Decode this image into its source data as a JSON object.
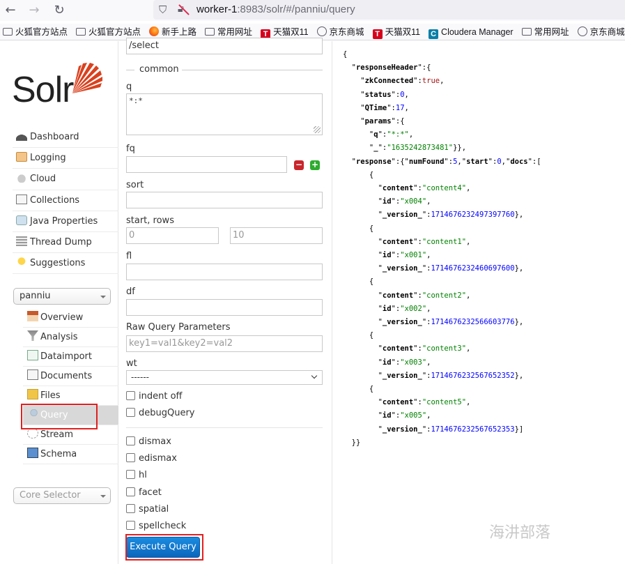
{
  "browser": {
    "url_host": "worker-1",
    "url_rest": ":8983/solr/#/panniu/query",
    "bookmarks": [
      {
        "icon": "folder-icon",
        "label": "火狐官方站点"
      },
      {
        "icon": "folder-icon",
        "label": "火狐官方站点"
      },
      {
        "icon": "firefox-icon",
        "label": "新手上路"
      },
      {
        "icon": "folder-icon",
        "label": "常用网址"
      },
      {
        "icon": "tmall-icon",
        "label": "天猫双11"
      },
      {
        "icon": "globe-icon",
        "label": "京东商城"
      },
      {
        "icon": "tmall-icon",
        "label": "天猫双11"
      },
      {
        "icon": "cloudera-icon",
        "label": "Cloudera Manager"
      },
      {
        "icon": "folder-icon",
        "label": "常用网址"
      },
      {
        "icon": "globe-icon",
        "label": "京东商城"
      }
    ]
  },
  "sidebar": {
    "logo_text": "Solr",
    "main_nav": [
      {
        "label": "Dashboard",
        "icon": "dashboard-icon"
      },
      {
        "label": "Logging",
        "icon": "logging-icon"
      },
      {
        "label": "Cloud",
        "icon": "cloud-icon"
      },
      {
        "label": "Collections",
        "icon": "collections-icon"
      },
      {
        "label": "Java Properties",
        "icon": "java-properties-icon"
      },
      {
        "label": "Thread Dump",
        "icon": "thread-dump-icon"
      },
      {
        "label": "Suggestions",
        "icon": "suggestions-icon"
      }
    ],
    "collection_selected": "panniu",
    "core_nav": [
      {
        "label": "Overview",
        "icon": "overview-icon"
      },
      {
        "label": "Analysis",
        "icon": "analysis-icon"
      },
      {
        "label": "Dataimport",
        "icon": "dataimport-icon"
      },
      {
        "label": "Documents",
        "icon": "documents-icon"
      },
      {
        "label": "Files",
        "icon": "files-icon"
      },
      {
        "label": "Query",
        "icon": "query-icon",
        "active": true
      },
      {
        "label": "Stream",
        "icon": "stream-icon"
      },
      {
        "label": "Schema",
        "icon": "schema-icon"
      }
    ],
    "core_selector_placeholder": "Core Selector"
  },
  "form": {
    "request_handler": "/select",
    "common_legend": "common",
    "q_label": "q",
    "q_value": "*:*",
    "fq_label": "fq",
    "fq_value": "",
    "sort_label": "sort",
    "sort_value": "",
    "start_rows_label": "start, rows",
    "start_placeholder": "0",
    "rows_placeholder": "10",
    "fl_label": "fl",
    "fl_value": "",
    "df_label": "df",
    "df_value": "",
    "raw_label": "Raw Query Parameters",
    "raw_placeholder": "key1=val1&key2=val2",
    "wt_label": "wt",
    "wt_value": "------",
    "checkboxes_top": [
      {
        "label": "indent off",
        "checked": false
      },
      {
        "label": "debugQuery",
        "checked": false
      }
    ],
    "checkboxes_bottom": [
      {
        "label": "dismax",
        "checked": false
      },
      {
        "label": "edismax",
        "checked": false
      },
      {
        "label": "hl",
        "checked": false
      },
      {
        "label": "facet",
        "checked": false
      },
      {
        "label": "spatial",
        "checked": false
      },
      {
        "label": "spellcheck",
        "checked": false
      }
    ],
    "execute_label": "Execute Query"
  },
  "result": {
    "responseHeader": {
      "zkConnected": "true",
      "status": "0",
      "QTime": "17",
      "params": {
        "q": "*:*",
        "_": "1635242873481"
      }
    },
    "response": {
      "numFound": "5",
      "start": "0",
      "docs": [
        {
          "content": "content4",
          "id": "x004",
          "_version_": "1714676232497397760"
        },
        {
          "content": "content1",
          "id": "x001",
          "_version_": "1714676232460697600"
        },
        {
          "content": "content2",
          "id": "x002",
          "_version_": "1714676232566603776"
        },
        {
          "content": "content3",
          "id": "x003",
          "_version_": "1714676232567652352"
        },
        {
          "content": "content5",
          "id": "x005",
          "_version_": "1714676232567652353"
        }
      ]
    }
  },
  "watermark": "海汫部落"
}
